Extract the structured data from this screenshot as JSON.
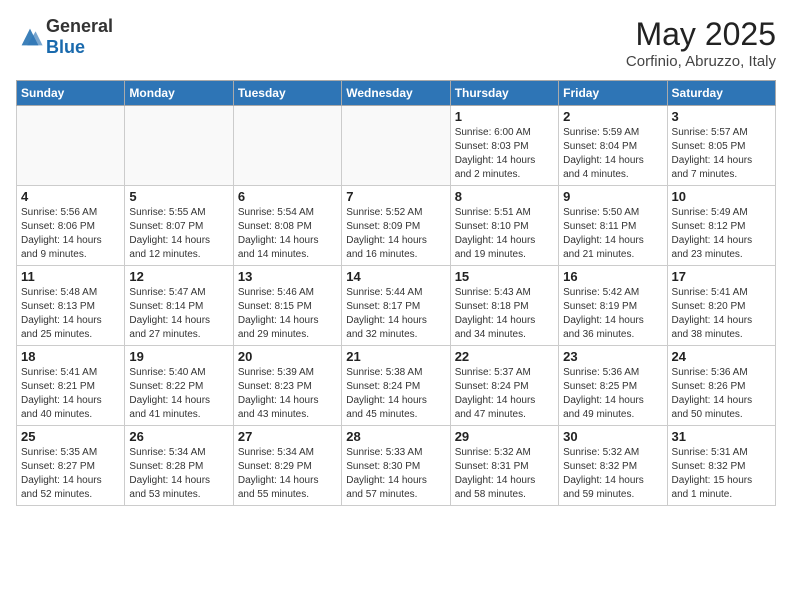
{
  "header": {
    "logo_general": "General",
    "logo_blue": "Blue",
    "month": "May 2025",
    "location": "Corfinio, Abruzzo, Italy"
  },
  "weekdays": [
    "Sunday",
    "Monday",
    "Tuesday",
    "Wednesday",
    "Thursday",
    "Friday",
    "Saturday"
  ],
  "weeks": [
    [
      {
        "day": "",
        "info": ""
      },
      {
        "day": "",
        "info": ""
      },
      {
        "day": "",
        "info": ""
      },
      {
        "day": "",
        "info": ""
      },
      {
        "day": "1",
        "info": "Sunrise: 6:00 AM\nSunset: 8:03 PM\nDaylight: 14 hours\nand 2 minutes."
      },
      {
        "day": "2",
        "info": "Sunrise: 5:59 AM\nSunset: 8:04 PM\nDaylight: 14 hours\nand 4 minutes."
      },
      {
        "day": "3",
        "info": "Sunrise: 5:57 AM\nSunset: 8:05 PM\nDaylight: 14 hours\nand 7 minutes."
      }
    ],
    [
      {
        "day": "4",
        "info": "Sunrise: 5:56 AM\nSunset: 8:06 PM\nDaylight: 14 hours\nand 9 minutes."
      },
      {
        "day": "5",
        "info": "Sunrise: 5:55 AM\nSunset: 8:07 PM\nDaylight: 14 hours\nand 12 minutes."
      },
      {
        "day": "6",
        "info": "Sunrise: 5:54 AM\nSunset: 8:08 PM\nDaylight: 14 hours\nand 14 minutes."
      },
      {
        "day": "7",
        "info": "Sunrise: 5:52 AM\nSunset: 8:09 PM\nDaylight: 14 hours\nand 16 minutes."
      },
      {
        "day": "8",
        "info": "Sunrise: 5:51 AM\nSunset: 8:10 PM\nDaylight: 14 hours\nand 19 minutes."
      },
      {
        "day": "9",
        "info": "Sunrise: 5:50 AM\nSunset: 8:11 PM\nDaylight: 14 hours\nand 21 minutes."
      },
      {
        "day": "10",
        "info": "Sunrise: 5:49 AM\nSunset: 8:12 PM\nDaylight: 14 hours\nand 23 minutes."
      }
    ],
    [
      {
        "day": "11",
        "info": "Sunrise: 5:48 AM\nSunset: 8:13 PM\nDaylight: 14 hours\nand 25 minutes."
      },
      {
        "day": "12",
        "info": "Sunrise: 5:47 AM\nSunset: 8:14 PM\nDaylight: 14 hours\nand 27 minutes."
      },
      {
        "day": "13",
        "info": "Sunrise: 5:46 AM\nSunset: 8:15 PM\nDaylight: 14 hours\nand 29 minutes."
      },
      {
        "day": "14",
        "info": "Sunrise: 5:44 AM\nSunset: 8:17 PM\nDaylight: 14 hours\nand 32 minutes."
      },
      {
        "day": "15",
        "info": "Sunrise: 5:43 AM\nSunset: 8:18 PM\nDaylight: 14 hours\nand 34 minutes."
      },
      {
        "day": "16",
        "info": "Sunrise: 5:42 AM\nSunset: 8:19 PM\nDaylight: 14 hours\nand 36 minutes."
      },
      {
        "day": "17",
        "info": "Sunrise: 5:41 AM\nSunset: 8:20 PM\nDaylight: 14 hours\nand 38 minutes."
      }
    ],
    [
      {
        "day": "18",
        "info": "Sunrise: 5:41 AM\nSunset: 8:21 PM\nDaylight: 14 hours\nand 40 minutes."
      },
      {
        "day": "19",
        "info": "Sunrise: 5:40 AM\nSunset: 8:22 PM\nDaylight: 14 hours\nand 41 minutes."
      },
      {
        "day": "20",
        "info": "Sunrise: 5:39 AM\nSunset: 8:23 PM\nDaylight: 14 hours\nand 43 minutes."
      },
      {
        "day": "21",
        "info": "Sunrise: 5:38 AM\nSunset: 8:24 PM\nDaylight: 14 hours\nand 45 minutes."
      },
      {
        "day": "22",
        "info": "Sunrise: 5:37 AM\nSunset: 8:24 PM\nDaylight: 14 hours\nand 47 minutes."
      },
      {
        "day": "23",
        "info": "Sunrise: 5:36 AM\nSunset: 8:25 PM\nDaylight: 14 hours\nand 49 minutes."
      },
      {
        "day": "24",
        "info": "Sunrise: 5:36 AM\nSunset: 8:26 PM\nDaylight: 14 hours\nand 50 minutes."
      }
    ],
    [
      {
        "day": "25",
        "info": "Sunrise: 5:35 AM\nSunset: 8:27 PM\nDaylight: 14 hours\nand 52 minutes."
      },
      {
        "day": "26",
        "info": "Sunrise: 5:34 AM\nSunset: 8:28 PM\nDaylight: 14 hours\nand 53 minutes."
      },
      {
        "day": "27",
        "info": "Sunrise: 5:34 AM\nSunset: 8:29 PM\nDaylight: 14 hours\nand 55 minutes."
      },
      {
        "day": "28",
        "info": "Sunrise: 5:33 AM\nSunset: 8:30 PM\nDaylight: 14 hours\nand 57 minutes."
      },
      {
        "day": "29",
        "info": "Sunrise: 5:32 AM\nSunset: 8:31 PM\nDaylight: 14 hours\nand 58 minutes."
      },
      {
        "day": "30",
        "info": "Sunrise: 5:32 AM\nSunset: 8:32 PM\nDaylight: 14 hours\nand 59 minutes."
      },
      {
        "day": "31",
        "info": "Sunrise: 5:31 AM\nSunset: 8:32 PM\nDaylight: 15 hours\nand 1 minute."
      }
    ]
  ]
}
